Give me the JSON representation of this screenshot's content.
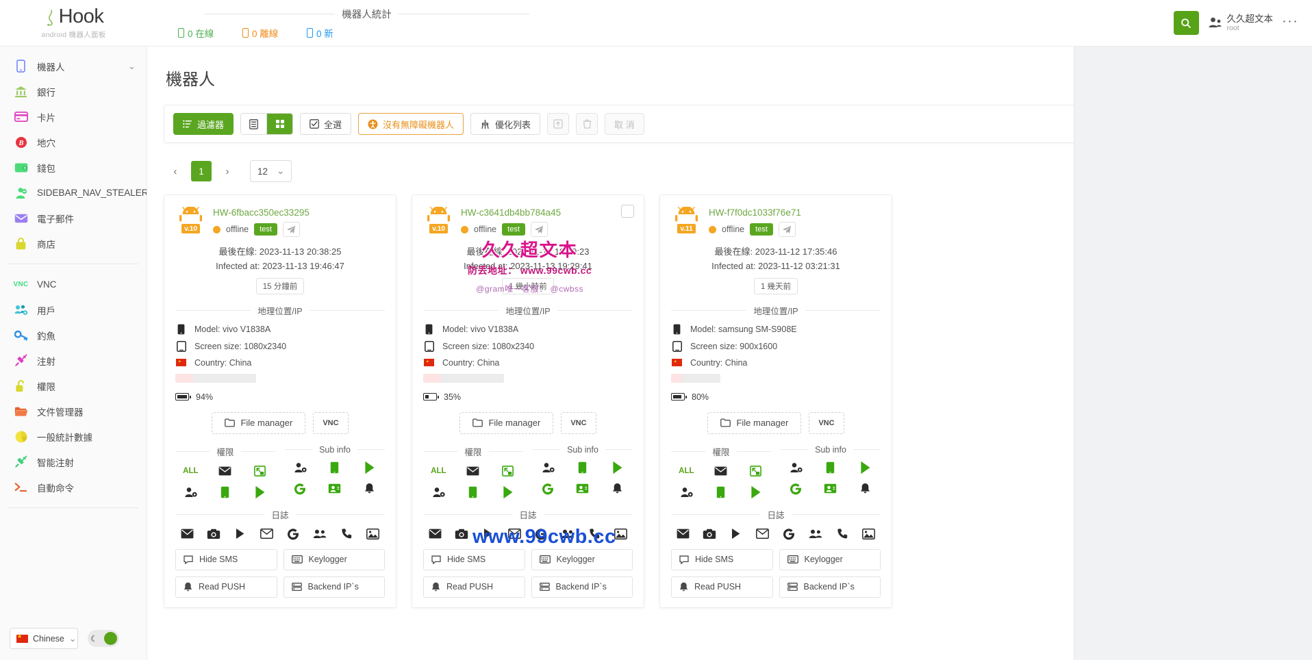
{
  "header": {
    "brand_name": "Hook",
    "brand_sub": "android 機器人面板",
    "stats_title": "機器人統計",
    "stats": [
      {
        "label": "0 在線",
        "kind": "online"
      },
      {
        "label": "0 離線",
        "kind": "offline"
      },
      {
        "label": "0 新",
        "kind": "new"
      }
    ],
    "search_icon": "search-icon",
    "user_name": "久久超文本",
    "user_role": "root",
    "more_label": "···"
  },
  "sidebar": {
    "items": [
      {
        "label": "機器人",
        "icon": "phone-icon",
        "chevron": "⌄"
      },
      {
        "label": "銀行",
        "icon": "bank-icon"
      },
      {
        "label": "卡片",
        "icon": "card-icon"
      },
      {
        "label": "地穴",
        "icon": "bitcoin-icon"
      },
      {
        "label": "錢包",
        "icon": "wallet-icon"
      },
      {
        "label": "SIDEBAR_NAV_STEALER",
        "icon": "stealer-icon"
      },
      {
        "label": "電子郵件",
        "icon": "mail-icon"
      },
      {
        "label": "商店",
        "icon": "bag-icon"
      }
    ],
    "items2": [
      {
        "label": "VNC",
        "icon": "vnc-icon"
      },
      {
        "label": "用戶",
        "icon": "users-icon"
      },
      {
        "label": "釣魚",
        "icon": "key-icon"
      },
      {
        "label": "注射",
        "icon": "syringe-icon"
      },
      {
        "label": "權限",
        "icon": "unlock-icon"
      },
      {
        "label": "文件管理器",
        "icon": "folder-icon"
      },
      {
        "label": "一般統計數據",
        "icon": "piechart-icon"
      },
      {
        "label": "智能注射",
        "icon": "syringe-green-icon"
      },
      {
        "label": "自動命令",
        "icon": "terminal-icon"
      }
    ],
    "language": "Chinese",
    "lang_chevron": "⌄",
    "theme_moon": "☾"
  },
  "main": {
    "page_title": "機器人",
    "toolbar": {
      "filter": "過濾器",
      "view_list_icon": "list-view-icon",
      "view_grid_icon": "grid-view-icon",
      "select_all": "全選",
      "no_accessibility": "沒有無障礙機器人",
      "optimize_list": "優化列表",
      "export_icon": "export-icon",
      "delete_icon": "trash-icon",
      "cancel": "取 消"
    },
    "pager": {
      "prev": "‹",
      "page": "1",
      "next": "›",
      "page_size": "12",
      "chevron": "⌄"
    }
  },
  "labels": {
    "last_online": "最後在線:",
    "infected_at": "Infected at:",
    "geo_ip": "地理位置/IP",
    "permissions": "權限",
    "sub_info": "Sub info",
    "logs": "日誌",
    "model": "Model:",
    "screen": "Screen size:",
    "country": "Country:",
    "file_manager": "File manager",
    "vnc": "VNC",
    "all": "ALL",
    "hide_sms": "Hide SMS",
    "keylogger": "Keylogger",
    "read_push": "Read PUSH",
    "backend_ip": "Backend IP`s"
  },
  "cards": [
    {
      "id": "HW-6fbacc350ec33295",
      "version": "v.10",
      "status": "offline",
      "tag": "test",
      "last_online": "2023-11-13 20:38:25",
      "infected_at": "2023-11-13 19:46:47",
      "time_badge": "15 分鐘前",
      "model": "vivo V1838A",
      "screen": "1080x2340",
      "country": "China",
      "battery": "94%",
      "battery_pct": 94,
      "checkbox": false
    },
    {
      "id": "HW-c3641db4bb784a45",
      "version": "v.10",
      "status": "offline",
      "tag": "test",
      "last_online": "2023-11-13 19:29:23",
      "infected_at": "2023-11-13 19:29:41",
      "time_badge": "1 幾小時前",
      "model": "vivo V1838A",
      "screen": "1080x2340",
      "country": "China",
      "battery": "35%",
      "battery_pct": 35,
      "checkbox": true
    },
    {
      "id": "HW-f7f0dc1033f76e71",
      "version": "v.11",
      "status": "offline",
      "tag": "test",
      "last_online": "2023-11-12 17:35:46",
      "infected_at": "2023-11-12 03:21:31",
      "time_badge": "1 幾天前",
      "model": "samsung SM-S908E",
      "screen": "900x1600",
      "country": "China",
      "battery": "80%",
      "battery_pct": 80,
      "checkbox": false
    }
  ],
  "watermark": {
    "main": "久久超文本",
    "sub": "防丢地址： www.99cwb.cc",
    "sub2": "@gram唯一客服： @cwbss",
    "bottom": "www.99cwb.cc"
  },
  "colors": {
    "green": "#5aa621",
    "orange": "#f5a623",
    "blue": "#2196f3",
    "link_green": "#6fa843"
  }
}
